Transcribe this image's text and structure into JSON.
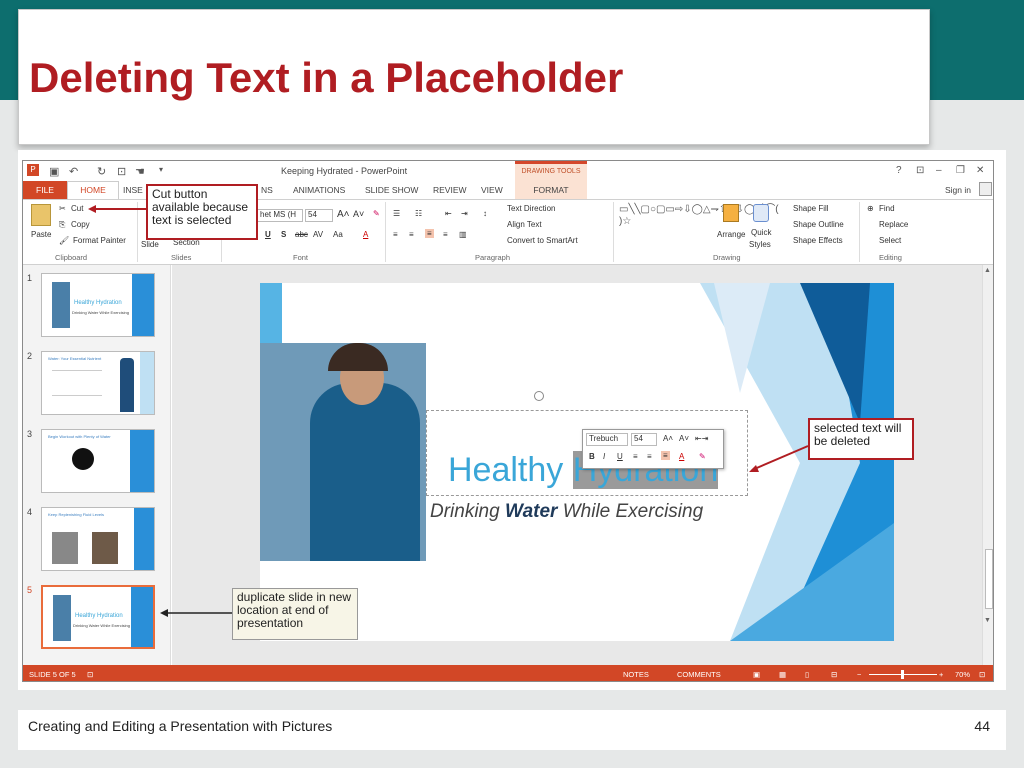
{
  "slide_title": "Deleting Text in a Placeholder",
  "window": {
    "title": "Keeping Hydrated - PowerPoint",
    "drawing_tools": "DRAWING TOOLS",
    "help": "?",
    "sign_in": "Sign in"
  },
  "tabs": [
    "FILE",
    "HOME",
    "INSE",
    "NS",
    "ANIMATIONS",
    "SLIDE SHOW",
    "REVIEW",
    "VIEW",
    "FORMAT"
  ],
  "ribbon": {
    "paste": "Paste",
    "cut": "Cut",
    "copy": "Copy",
    "format_painter": "Format Painter",
    "clipboard": "Clipboard",
    "slide_btn": "Slide",
    "section": "Section",
    "slides": "Slides",
    "font_name": "het MS (H",
    "font_size": "54",
    "font": "Font",
    "text_direction": "Text Direction",
    "align_text": "Align Text",
    "convert_smartart": "Convert to SmartArt",
    "paragraph": "Paragraph",
    "arrange": "Arrange",
    "quick": "Quick",
    "styles": "Styles",
    "shape_fill": "Shape Fill",
    "shape_outline": "Shape Outline",
    "shape_effects": "Shape Effects",
    "drawing": "Drawing",
    "find": "Find",
    "replace": "Replace",
    "select": "Select",
    "editing": "Editing",
    "font_marks": [
      "U",
      "S",
      "abc",
      "AV",
      "Aa",
      "A"
    ]
  },
  "thumbnails": [
    {
      "num": "1",
      "title": "Healthy Hydration",
      "sub": "Drinking Water While Exercising"
    },
    {
      "num": "2",
      "title": "Water: Your Essential Nutrient",
      "sub": ""
    },
    {
      "num": "3",
      "title": "Begin Workout with Plenty of Water",
      "sub": ""
    },
    {
      "num": "4",
      "title": "Keep Replenishing Fluid Levels",
      "sub": ""
    },
    {
      "num": "5",
      "title": "Healthy Hydration",
      "sub": "Drinking Water While Exercising"
    }
  ],
  "slide": {
    "title_normal": "Healthy ",
    "title_selected": "Hydration",
    "subtitle_a": "Drinking ",
    "subtitle_b": "Water",
    "subtitle_c": " While Exercising"
  },
  "mini_toolbar": {
    "font": "Trebuch",
    "size": "54",
    "bold": "B",
    "italic": "I",
    "underline": "U"
  },
  "status": {
    "slide": "SLIDE 5 OF 5",
    "notes": "NOTES",
    "comments": "COMMENTS",
    "zoom": "70%"
  },
  "callouts": {
    "cut": "Cut button available because text is selected",
    "selected": "selected text will be deleted",
    "duplicate": "duplicate slide in new location at end of presentation"
  },
  "footer": {
    "text": "Creating and Editing a Presentation with Pictures",
    "page": "44"
  },
  "colors": {
    "accent": "#d24726",
    "title_red": "#b01d22",
    "teal": "#0d6e6e",
    "slide_blue": "#1e8fd6"
  }
}
